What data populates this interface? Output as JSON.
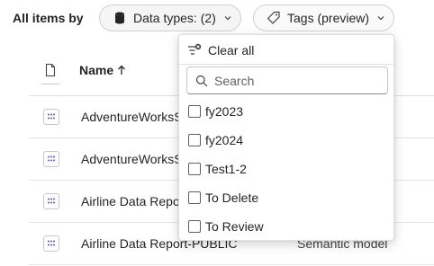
{
  "filter_bar": {
    "label": "All items by",
    "data_types_label": "Data types: (2)",
    "tags_label": "Tags (preview)"
  },
  "table": {
    "name_header": "Name",
    "rows": [
      {
        "name": "AdventureWorksS",
        "type": ""
      },
      {
        "name": "AdventureWorksS",
        "type": ""
      },
      {
        "name": "Airline Data Repor",
        "type": ""
      },
      {
        "name": "Airline Data Report-PUBLIC",
        "type": "Semantic model"
      }
    ]
  },
  "tags_dropdown": {
    "clear_all_label": "Clear all",
    "search_placeholder": "Search",
    "options": [
      {
        "label": "fy2023",
        "checked": false
      },
      {
        "label": "fy2024",
        "checked": false
      },
      {
        "label": "Test1-2",
        "checked": false
      },
      {
        "label": "To Delete",
        "checked": false
      },
      {
        "label": "To Review",
        "checked": false
      }
    ]
  },
  "icons": {
    "data_types": "database-icon",
    "tags": "tag-icon",
    "chevron": "chevron-down-icon",
    "column": "document-icon",
    "sort": "arrow-up-icon",
    "item": "semantic-model-icon",
    "clear": "clear-filter-icon",
    "search": "search-icon"
  }
}
